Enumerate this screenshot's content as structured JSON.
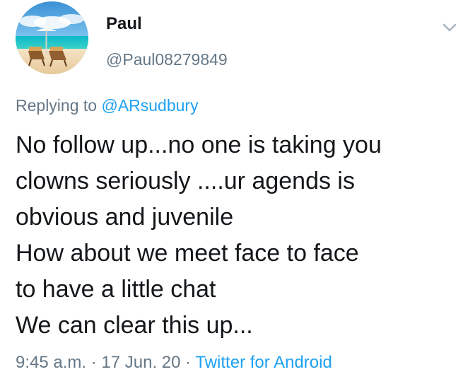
{
  "user": {
    "display_name": "Paul",
    "handle": "@Paul08279849",
    "avatar_icon": "beach-avatar-icon"
  },
  "menu": {
    "icon": "chevron-down-icon"
  },
  "reply": {
    "prefix": "Replying to",
    "mention": "@ARsudbury"
  },
  "tweet": {
    "lines": [
      "No follow up...no one is taking you",
      "clowns seriously ....ur agends is",
      "obvious and juvenile",
      "How about we meet face to face",
      "to have a little chat",
      "We can clear this up..."
    ]
  },
  "meta": {
    "time": "9:45 a.m.",
    "separator_1": " · ",
    "date": "17 Jun. 20",
    "separator_2": " · ",
    "source": "Twitter for Android"
  },
  "colors": {
    "text": "#14171a",
    "secondary": "#657786",
    "link": "#1da1f2",
    "background": "#ffffff"
  }
}
